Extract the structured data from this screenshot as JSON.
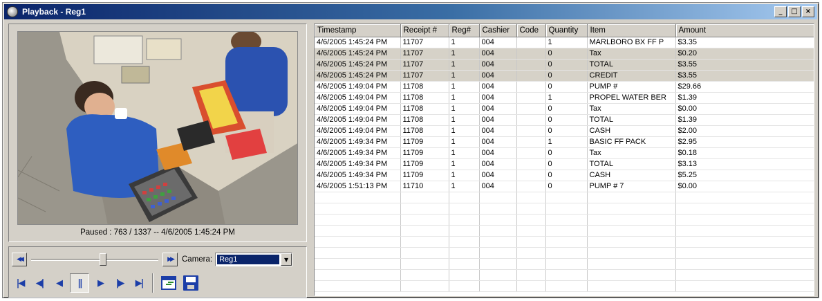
{
  "window": {
    "title": "Playback - Reg1",
    "controls": {
      "minimize": "_",
      "maximize": "□",
      "close": "×"
    }
  },
  "video": {
    "status": "Paused : 763 / 1337 -- 4/6/2005 1:45:24 PM"
  },
  "seek": {
    "rewind_icon": "fast-rewind-icon",
    "forward_icon": "fast-forward-icon",
    "position_fraction": 0.57
  },
  "camera": {
    "label": "Camera:",
    "selected": "Reg1"
  },
  "playback_buttons": [
    {
      "name": "first-frame-button",
      "glyph": "|◀"
    },
    {
      "name": "step-back-button",
      "glyph": "◀|"
    },
    {
      "name": "play-reverse-button",
      "glyph": "◀"
    },
    {
      "name": "pause-button",
      "glyph": "||"
    },
    {
      "name": "play-button",
      "glyph": "▶"
    },
    {
      "name": "step-forward-button",
      "glyph": "|▶"
    },
    {
      "name": "last-frame-button",
      "glyph": "▶|"
    }
  ],
  "colors": {
    "title_gradient_start": "#0a246a",
    "icon_blue": "#1c3ea8",
    "selected_row": "#d6d2c8"
  },
  "grid": {
    "columns": [
      "Timestamp",
      "Receipt #",
      "Reg#",
      "Cashier",
      "Code",
      "Quantity",
      "Item",
      "Amount"
    ],
    "rows": [
      {
        "selected": false,
        "cells": [
          "4/6/2005 1:45:24 PM",
          "11707",
          "1",
          "004",
          "",
          "1",
          "MARLBORO BX FF P",
          "$3.35"
        ]
      },
      {
        "selected": true,
        "cells": [
          "4/6/2005 1:45:24 PM",
          "11707",
          "1",
          "004",
          "",
          "0",
          "Tax",
          "$0.20"
        ]
      },
      {
        "selected": true,
        "cells": [
          "4/6/2005 1:45:24 PM",
          "11707",
          "1",
          "004",
          "",
          "0",
          "TOTAL",
          "$3.55"
        ]
      },
      {
        "selected": true,
        "cells": [
          "4/6/2005 1:45:24 PM",
          "11707",
          "1",
          "004",
          "",
          "0",
          "CREDIT",
          "$3.55"
        ]
      },
      {
        "selected": false,
        "cells": [
          "4/6/2005 1:49:04 PM",
          "11708",
          "1",
          "004",
          "",
          "0",
          "PUMP #",
          "$29.66"
        ]
      },
      {
        "selected": false,
        "cells": [
          "4/6/2005 1:49:04 PM",
          "11708",
          "1",
          "004",
          "",
          "1",
          "PROPEL WATER BER",
          "$1.39"
        ]
      },
      {
        "selected": false,
        "cells": [
          "4/6/2005 1:49:04 PM",
          "11708",
          "1",
          "004",
          "",
          "0",
          "Tax",
          "$0.00"
        ]
      },
      {
        "selected": false,
        "cells": [
          "4/6/2005 1:49:04 PM",
          "11708",
          "1",
          "004",
          "",
          "0",
          "TOTAL",
          "$1.39"
        ]
      },
      {
        "selected": false,
        "cells": [
          "4/6/2005 1:49:04 PM",
          "11708",
          "1",
          "004",
          "",
          "0",
          "CASH",
          "$2.00"
        ]
      },
      {
        "selected": false,
        "cells": [
          "4/6/2005 1:49:34 PM",
          "11709",
          "1",
          "004",
          "",
          "1",
          "BASIC FF PACK",
          "$2.95"
        ]
      },
      {
        "selected": false,
        "cells": [
          "4/6/2005 1:49:34 PM",
          "11709",
          "1",
          "004",
          "",
          "0",
          "Tax",
          "$0.18"
        ]
      },
      {
        "selected": false,
        "cells": [
          "4/6/2005 1:49:34 PM",
          "11709",
          "1",
          "004",
          "",
          "0",
          "TOTAL",
          "$3.13"
        ]
      },
      {
        "selected": false,
        "cells": [
          "4/6/2005 1:49:34 PM",
          "11709",
          "1",
          "004",
          "",
          "0",
          "CASH",
          "$5.25"
        ]
      },
      {
        "selected": false,
        "cells": [
          "4/6/2005 1:51:13 PM",
          "11710",
          "1",
          "004",
          "",
          "0",
          "PUMP # 7",
          "$0.00"
        ]
      }
    ],
    "empty_rows": 9
  }
}
